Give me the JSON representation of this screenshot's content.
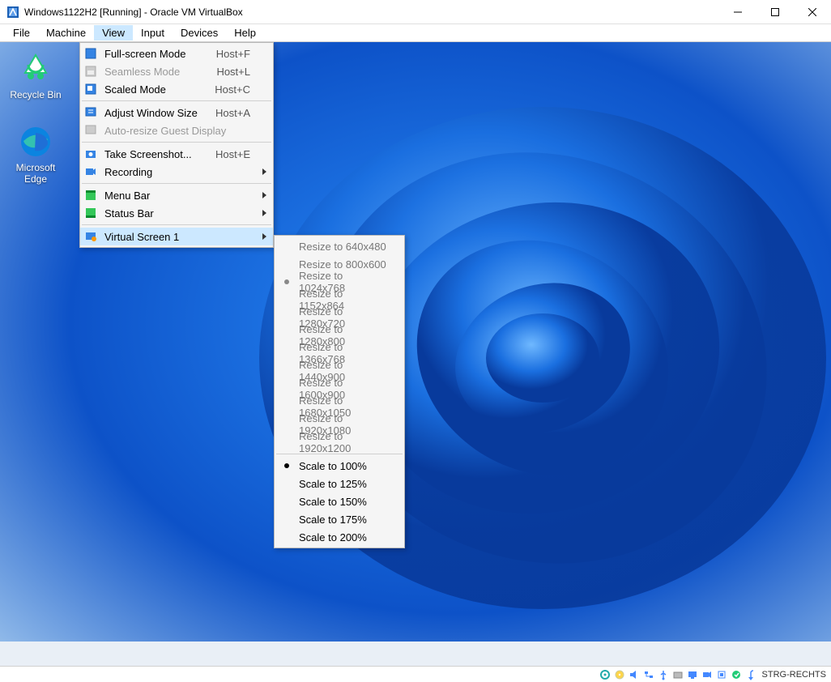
{
  "window": {
    "title": "Windows1122H2 [Running] - Oracle VM VirtualBox"
  },
  "menubar": {
    "items": [
      "File",
      "Machine",
      "View",
      "Input",
      "Devices",
      "Help"
    ],
    "open_index": 2
  },
  "desktop_icons": {
    "recycle_bin": "Recycle Bin",
    "edge": "Microsoft Edge"
  },
  "view_menu": {
    "fullscreen": {
      "label": "Full-screen Mode",
      "shortcut": "Host+F"
    },
    "seamless": {
      "label": "Seamless Mode",
      "shortcut": "Host+L"
    },
    "scaled": {
      "label": "Scaled Mode",
      "shortcut": "Host+C"
    },
    "adjust_win": {
      "label": "Adjust Window Size",
      "shortcut": "Host+A"
    },
    "autoresize": {
      "label": "Auto-resize Guest Display"
    },
    "take_ss": {
      "label": "Take Screenshot...",
      "shortcut": "Host+E"
    },
    "recording": {
      "label": "Recording"
    },
    "menubar": {
      "label": "Menu Bar"
    },
    "statusbar": {
      "label": "Status Bar"
    },
    "virtscr": {
      "label": "Virtual Screen 1"
    }
  },
  "virtual_screen_submenu": {
    "resize": [
      "Resize to 640x480",
      "Resize to 800x600",
      "Resize to 1024x768",
      "Resize to 1152x864",
      "Resize to 1280x720",
      "Resize to 1280x800",
      "Resize to 1366x768",
      "Resize to 1440x900",
      "Resize to 1600x900",
      "Resize to 1680x1050",
      "Resize to 1920x1080",
      "Resize to 1920x1200"
    ],
    "resize_selected_index": 2,
    "scale": [
      "Scale to 100%",
      "Scale to 125%",
      "Scale to 150%",
      "Scale to 175%",
      "Scale to 200%"
    ],
    "scale_selected_index": 0
  },
  "statusbar": {
    "host_key": "STRG-RECHTS"
  }
}
